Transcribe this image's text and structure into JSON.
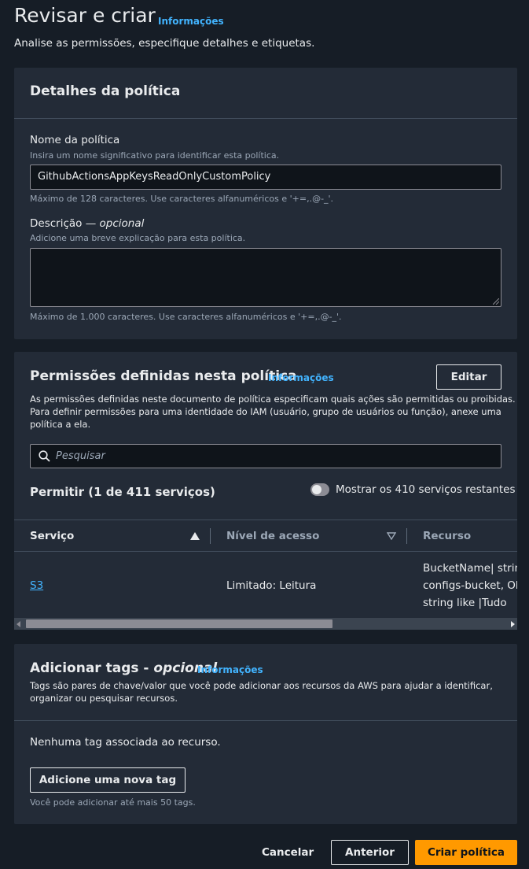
{
  "header": {
    "title": "Revisar e criar",
    "info": "Informações",
    "subtitle": "Analise as permissões, especifique detalhes e etiquetas."
  },
  "details": {
    "title": "Detalhes da política",
    "name_label": "Nome da política",
    "name_hint": "Insira um nome significativo para identificar esta política.",
    "name_value": "GithubActionsAppKeysReadOnlyCustomPolicy",
    "name_constraint": "Máximo de 128 caracteres. Use caracteres alfanuméricos e '+=,.@-_'.",
    "desc_label": "Descrição — ",
    "desc_optional": "opcional",
    "desc_hint": "Adicione uma breve explicação para esta política.",
    "desc_value": "",
    "desc_constraint": "Máximo de 1.000 caracteres. Use caracteres alfanuméricos e '+=,.@-_'."
  },
  "permissions": {
    "title": "Permissões definidas nesta política",
    "info": "Informações",
    "edit_label": "Editar",
    "description_line1": "As permissões definidas neste documento de política especificam quais ações são permitidas ou proibidas.",
    "description_line2": "Para definir permissões para uma identidade do IAM (usuário, grupo de usuários ou função), anexe uma",
    "description_line3": "política a ela.",
    "search_placeholder": "Pesquisar",
    "allow_heading": "Permitir (1 de 411 serviços)",
    "toggle_label": "Mostrar os 410 serviços restantes",
    "toggle_on": false,
    "columns": [
      "Serviço",
      "Nível de acesso",
      "Recurso"
    ],
    "rows": [
      {
        "service": "S3",
        "access": "Limitado: Leitura",
        "resource_line1": "BucketName| string",
        "resource_line2": "configs-bucket, Ob",
        "resource_line3": "string like |Tudo"
      }
    ]
  },
  "tags": {
    "title": "Adicionar tags - ",
    "title_optional": "opcional",
    "info": "Informações",
    "description_line1": "Tags são pares de chave/valor que você pode adicionar aos recursos da AWS para ajudar a identificar,",
    "description_line2": "organizar ou pesquisar recursos.",
    "empty_text": "Nenhuma tag associada ao recurso.",
    "add_label": "Adicione uma nova tag",
    "limit_text": "Você pode adicionar até mais 50 tags."
  },
  "footer": {
    "cancel_label": "Cancelar",
    "previous_label": "Anterior",
    "create_label": "Criar política"
  },
  "colors": {
    "background": "#161d26",
    "panel": "#232b37",
    "link": "#42b4ff",
    "primary": "#ff9900"
  }
}
